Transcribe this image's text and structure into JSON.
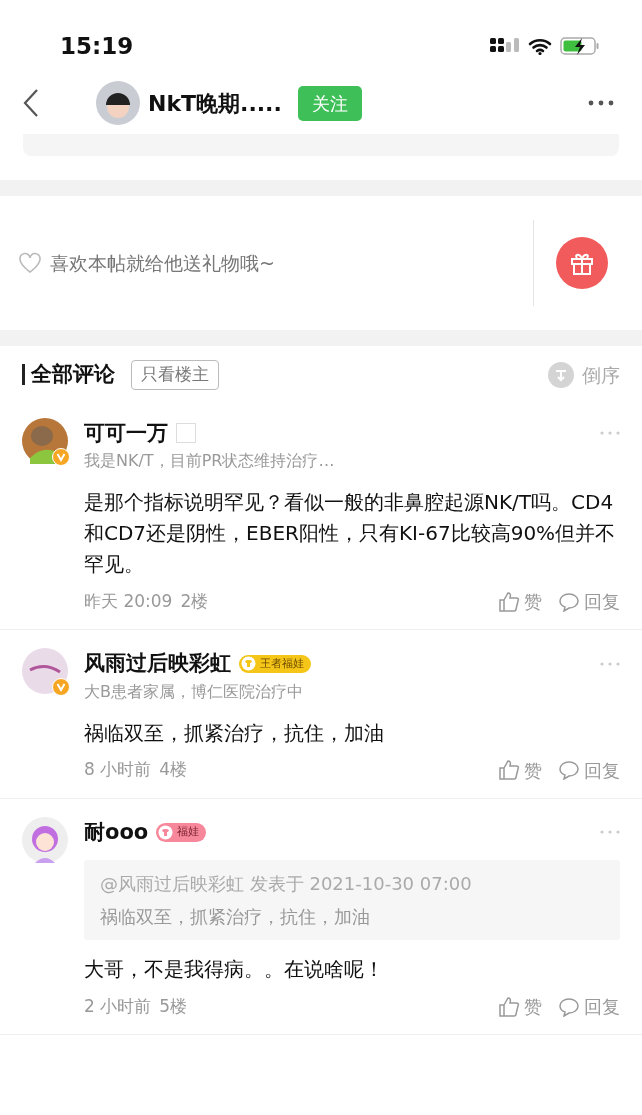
{
  "status_bar": {
    "time": "15:19"
  },
  "nav": {
    "title": "NkT晚期.....",
    "follow_label": "关注",
    "following": false
  },
  "gift": {
    "prompt": "喜欢本帖就给他送礼物哦~"
  },
  "comments_header": {
    "title": "全部评论",
    "filter_label": "只看楼主",
    "filter_selected": false,
    "sort_label": "倒序"
  },
  "comments": [
    {
      "name": "可可一万",
      "verified": true,
      "badge": {
        "kind": "empty"
      },
      "bio": "我是NK/T，目前PR状态维持治疗…",
      "text": "是那个指标说明罕见？看似一般的非鼻腔起源NK/T吗。CD4和CD7还是阴性，EBER阳性，只有KI-67比较高90%但并不罕见。",
      "time": "昨天 20:09",
      "floor": "2楼",
      "like_label": "赞",
      "reply_label": "回复"
    },
    {
      "name": "风雨过后映彩虹",
      "verified": true,
      "badge": {
        "kind": "gold",
        "label": "王者福娃",
        "color": "#f5c518"
      },
      "bio": "大B患者家属，博仁医院治疗中",
      "text": "祸临双至，抓紧治疗，抗住，加油",
      "time": "8 小时前",
      "floor": "4楼",
      "like_label": "赞",
      "reply_label": "回复"
    },
    {
      "name": "耐ooo",
      "verified": false,
      "badge": {
        "kind": "pink",
        "label": "福娃",
        "color": "#f7879a"
      },
      "quote": {
        "header": "@风雨过后映彩虹 发表于 2021-10-30 07:00",
        "text": "祸临双至，抓紧治疗，抗住，加油"
      },
      "text": "大哥，不是我得病。。在说啥呢！",
      "time": "2 小时前",
      "floor": "5楼",
      "like_label": "赞",
      "reply_label": "回复"
    }
  ]
}
